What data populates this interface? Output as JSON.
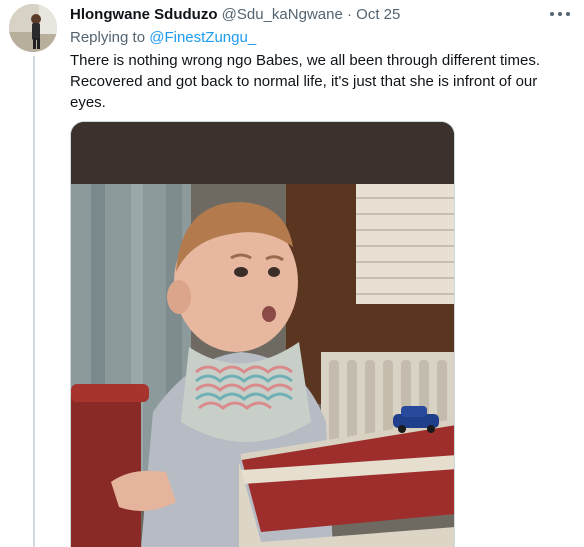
{
  "tweet": {
    "author_name": "Hlongwane Sduduzo",
    "author_handle": "@Sdu_kaNgwane",
    "separator": "·",
    "date": "Oct 25",
    "replying_prefix": "Replying to",
    "replying_to": "@FinestZungu_",
    "text": "There is nothing wrong ngo Babes, we all been through different times. Recovered and got back to normal life, it's just that she is infront of our eyes."
  },
  "icons": {
    "more": "more-horizontal-icon",
    "avatar": "profile-photo"
  },
  "colors": {
    "link": "#1d9bf0",
    "secondary_text": "#536471",
    "thread_line": "#cfd9de"
  }
}
